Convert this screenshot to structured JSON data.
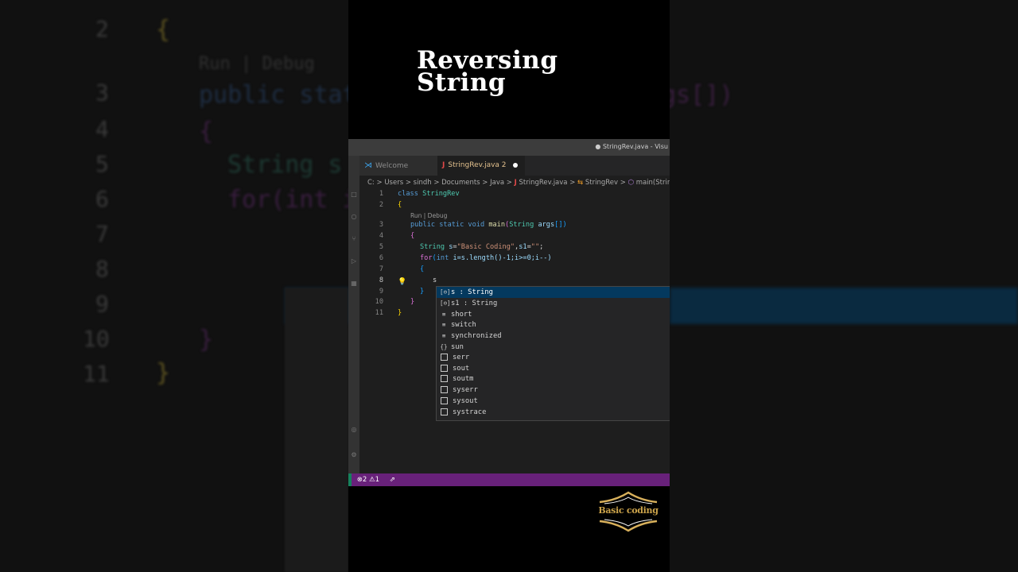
{
  "video_title": [
    "Reversing",
    "String"
  ],
  "window": {
    "title": "● StringRev.java - Visu"
  },
  "tabs": [
    {
      "label": "Welcome",
      "icon": "vscode-icon"
    },
    {
      "label": "StringRev.java 2",
      "icon": "java-icon",
      "modified": true
    }
  ],
  "breadcrumb": {
    "path": "C: > Users > sindh > Documents > Java >",
    "file": "StringRev.java",
    "class": "StringRev",
    "method": "main(Strin"
  },
  "editor": {
    "codelens": "Run | Debug",
    "lines": [
      "1",
      "2",
      "3",
      "4",
      "5",
      "6",
      "7",
      "8",
      "9",
      "10",
      "11"
    ],
    "code": {
      "l1_kw": "class",
      "l1_name": "StringRev",
      "l2": "{",
      "l3_a": "public static void",
      "l3_b": "main",
      "l3_c": "(",
      "l3_d": "String",
      "l3_e": "args",
      "l3_f": "[])",
      "l4": "{",
      "l5_a": "String",
      "l5_b": "s",
      "l5_c": "=",
      "l5_d": "\"Basic Coding\"",
      "l5_e": ",",
      "l5_f": "s1",
      "l5_g": "=",
      "l5_h": "\"\"",
      "l5_i": ";",
      "l6_a": "for",
      "l6_b": "(",
      "l6_c": "int",
      "l6_d": "i=s.length()-1;i>=0;i--)",
      "l7": "{",
      "l8": "s",
      "l9": "}",
      "l10": "}",
      "l11": "}"
    }
  },
  "suggestions": [
    {
      "icon": "[⊖]",
      "label": "s : String",
      "selected": true
    },
    {
      "icon": "[⊖]",
      "label": "s1 : String"
    },
    {
      "icon": "≡",
      "label": "short"
    },
    {
      "icon": "≡",
      "label": "switch"
    },
    {
      "icon": "≡",
      "label": "synchronized"
    },
    {
      "icon": "{}",
      "label": "sun"
    },
    {
      "icon": "",
      "label": "serr"
    },
    {
      "icon": "",
      "label": "sout"
    },
    {
      "icon": "",
      "label": "soutm"
    },
    {
      "icon": "",
      "label": "syserr"
    },
    {
      "icon": "",
      "label": "sysout"
    },
    {
      "icon": "",
      "label": "systrace"
    }
  ],
  "statusbar": {
    "errors": "2",
    "warnings": "1"
  },
  "watermark": "Basic coding",
  "colors": {
    "statusbar": "#68217a",
    "selection": "#04395e",
    "editor_bg": "#1e1e1e"
  }
}
